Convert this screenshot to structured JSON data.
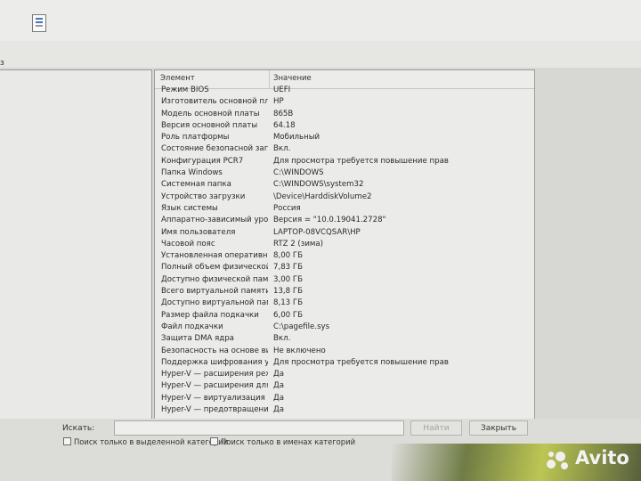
{
  "menu": {
    "item": "з"
  },
  "list": {
    "col_element": "Элемент",
    "col_value": "Значение",
    "rows": [
      {
        "k": "Режим BIOS",
        "v": "UEFI"
      },
      {
        "k": "Изготовитель основной платы",
        "v": "HP"
      },
      {
        "k": "Модель основной платы",
        "v": "865B"
      },
      {
        "k": "Версия основной платы",
        "v": "64.18"
      },
      {
        "k": "Роль платформы",
        "v": "Мобильный"
      },
      {
        "k": "Состояние безопасной загруз...",
        "v": "Вкл."
      },
      {
        "k": "Конфигурация PCR7",
        "v": "Для просмотра требуется повышение прав"
      },
      {
        "k": "Папка Windows",
        "v": "C:\\WINDOWS"
      },
      {
        "k": "Системная папка",
        "v": "C:\\WINDOWS\\system32"
      },
      {
        "k": "Устройство загрузки",
        "v": "\\Device\\HarddiskVolume2"
      },
      {
        "k": "Язык системы",
        "v": "Россия"
      },
      {
        "k": "Аппаратно-зависимый уровен...",
        "v": "Версия = \"10.0.19041.2728\""
      },
      {
        "k": "Имя пользователя",
        "v": "LAPTOP-08VCQSAR\\HP"
      },
      {
        "k": "Часовой пояс",
        "v": "RTZ 2 (зима)"
      },
      {
        "k": "Установленная оперативная п...",
        "v": "8,00 ГБ"
      },
      {
        "k": "Полный объем физической па...",
        "v": "7,83 ГБ"
      },
      {
        "k": "Доступно физической памяти",
        "v": "3,00 ГБ"
      },
      {
        "k": "Всего виртуальной памяти",
        "v": "13,8 ГБ"
      },
      {
        "k": "Доступно виртуальной памяти",
        "v": "8,13 ГБ"
      },
      {
        "k": "Размер файла подкачки",
        "v": "6,00 ГБ"
      },
      {
        "k": "Файл подкачки",
        "v": "C:\\pagefile.sys"
      },
      {
        "k": "Защита DMA ядра",
        "v": "Вкл."
      },
      {
        "k": "Безопасность на основе вирту...",
        "v": "Не включено"
      },
      {
        "k": "Поддержка шифрования устр...",
        "v": "Для просмотра требуется повышение прав"
      },
      {
        "k": "Hyper-V — расширения режи...",
        "v": "Да"
      },
      {
        "k": "Hyper-V — расширения для п...",
        "v": "Да"
      },
      {
        "k": "Hyper-V — виртуализация вкл...",
        "v": "Да"
      },
      {
        "k": "Hyper-V — предотвращение в...",
        "v": "Да"
      }
    ]
  },
  "search": {
    "label": "Искать:",
    "value": "",
    "find_label": "Найти",
    "close_label": "Закрыть",
    "option1": "Поиск только в выделенной категории",
    "option2": "Поиск только в именах категорий"
  },
  "watermark": {
    "text": "Avito"
  }
}
